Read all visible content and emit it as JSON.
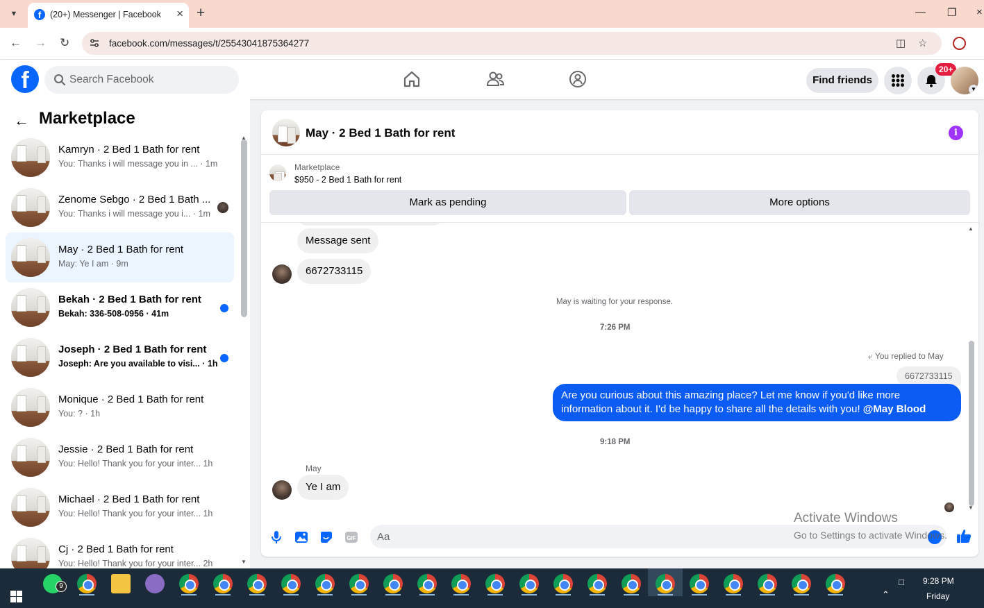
{
  "browser": {
    "tab_title": "(20+) Messenger | Facebook",
    "url": "facebook.com/messages/t/25543041875364277"
  },
  "fb_header": {
    "logo": "f",
    "search_placeholder": "Search Facebook",
    "find_friends_label": "Find friends",
    "notification_badge": "20+"
  },
  "sidebar": {
    "title": "Marketplace",
    "conversations": [
      {
        "name": "Kamryn · 2 Bed 1 Bath for rent",
        "preview": "You: Thanks i will message you in ...",
        "time": "· 1m",
        "status": "read"
      },
      {
        "name": "Zenome Sebgo · 2 Bed 1 Bath ...",
        "preview": "You: Thanks i will message you i...",
        "time": "· 1m",
        "status": "seen"
      },
      {
        "name": "May · 2 Bed 1 Bath for rent",
        "preview": "May: Ye I am",
        "time": "· 9m",
        "status": "active"
      },
      {
        "name": "Bekah · 2 Bed 1 Bath for rent",
        "preview": "Bekah: 336-508-0956",
        "time": "· 41m",
        "status": "unread"
      },
      {
        "name": "Joseph · 2 Bed 1 Bath for rent",
        "preview": "Joseph: Are you available to visi...",
        "time": "· 1h",
        "status": "unread"
      },
      {
        "name": "Monique · 2 Bed 1 Bath for rent",
        "preview": "You: ?",
        "time": "· 1h",
        "status": "read"
      },
      {
        "name": "Jessie · 2 Bed 1 Bath for rent",
        "preview": "You: Hello! Thank you for your inter...",
        "time": "1h",
        "status": "read"
      },
      {
        "name": "Michael · 2 Bed 1 Bath for rent",
        "preview": "You: Hello! Thank you for your inter...",
        "time": "1h",
        "status": "read"
      },
      {
        "name": "Cj · 2 Bed 1 Bath for rent",
        "preview": "You: Hello! Thank you for your inter...",
        "time": "2h",
        "status": "read"
      }
    ]
  },
  "chat": {
    "title": "May · 2 Bed 1 Bath for rent",
    "listing_label": "Marketplace",
    "listing_price": "$950 - 2 Bed 1 Bath for rent",
    "mark_pending_label": "Mark as pending",
    "more_options_label": "More options",
    "messages": {
      "message_sent": "Message sent",
      "phone": "6672733115",
      "waiting": "May is waiting for your response.",
      "time1": "7:26 PM",
      "reply_header": "You replied to May",
      "quoted": "6672733115",
      "outgoing_text": "Are you curious about this amazing place? Let me know if you'd like more information about it. I'd be happy to share all the details with you! ",
      "outgoing_mention": "@May Blood",
      "time2": "9:18 PM",
      "sender": "May",
      "last_reply": "Ye I am"
    },
    "composer_placeholder": "Aa"
  },
  "watermark": {
    "line1": "Activate Windows",
    "line2": "Go to Settings to activate Windows."
  },
  "taskbar": {
    "clock": "9:28 PM",
    "day": "Friday",
    "whatsapp_badge": "9"
  }
}
